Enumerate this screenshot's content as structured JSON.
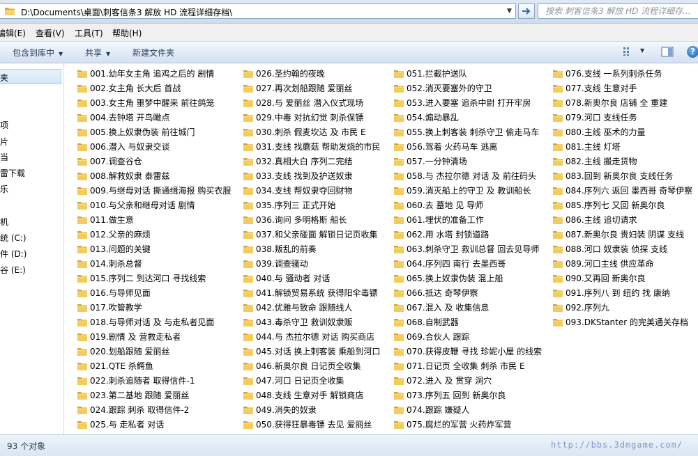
{
  "address": {
    "path": "D:\\Documents\\桌面\\刺客信条3 解放 HD 流程详细存档\\",
    "search_placeholder": "搜索 刺客信条3 解放 HD 流程详细存..."
  },
  "menu": [
    "编辑(E)",
    "查看(V)",
    "工具(T)",
    "帮助(H)"
  ],
  "toolbar": {
    "include_library": "包含到库中",
    "share": "共享",
    "new_folder": "新建文件夹"
  },
  "nav": [
    "夹",
    "项",
    "片",
    "当",
    "雷下载",
    "乐",
    "机",
    "统 (C:)",
    "件 (D:)",
    "谷 (E:)"
  ],
  "files": [
    "001.幼年女主角 追鸡之后的 剧情",
    "002.女主角 长大后 首战",
    "003.女主角 噩梦中醒来 前往鸽笼",
    "004.去钟塔 开鸟瞰点",
    "005.换上奴隶伪装 前往城门",
    "006.潜入 与奴隶交谈",
    "007.调查谷仓",
    "008.解救奴隶 泰雷兹",
    "009.与继母对话 撕通缉海报 购买衣服",
    "010.与父亲和继母对话 剧情",
    "011.做生意",
    "012.父亲的麻烦",
    "013.问题的关键",
    "014.刺杀总督",
    "015.序列二 到达河口 寻找线索",
    "016.与导师见面",
    "017.吹管教学",
    "018.与导师对话 及 与走私者见面",
    "019.剧情 及 营救走私者",
    "020.划船跟随 爱丽丝",
    "021.QTE 杀鳄鱼",
    "022.刺杀追随者 取得信件-1",
    "023.第二基地 跟随 爱丽丝",
    "024.跟踪 刺杀 取得信件-2",
    "025.与 走私者 对话",
    "026.圣约翰的夜晚",
    "027.再次划船跟随 爱丽丝",
    "028.与 爱丽丝 潜入仪式现场",
    "029.中毒 对抗幻觉 刺杀保镖",
    "030.刺杀 假麦坎达 及 市民 E",
    "031.支线 找蘑菇 帮助发烧的市民",
    "032.真相大白 序列二完结",
    "033.支线 找到及护送奴隶",
    "034.支线 帮奴隶夺回财物",
    "035.序列三 正式开始",
    "036.询问 多明格斯 船长",
    "037.和父亲碰面 解锁日记页收集",
    "038.叛乱的前奏",
    "039.调查骚动",
    "040.与 骚动者 对话",
    "041.解锁贸易系统 获得阳伞毒镖",
    "042.优雅与致命 跟随线人",
    "043.毒杀守卫 救训奴隶贩",
    "044.与 杰拉尔德 对话 购买商店",
    "045.对话 换上刺客装 乘船到河口",
    "046.新奥尔良 日记页全收集",
    "047.河口 日记页全收集",
    "048.支线 生意对手 解锁商店",
    "049.消失的奴隶",
    "050.获得狂暴毒镖 去见 爱丽丝",
    "051.拦截护送队",
    "052.消灭要塞外的守卫",
    "053.进入要塞 追杀中尉 打开牢房",
    "054.煽动暴乱",
    "055.换上刺客装 刺杀守卫 偷走马车",
    "056.驾着 火药马车 逃离",
    "057.一分钟清场",
    "058.与 杰拉尔德 对话 及 前往码头",
    "059.消灭船上的守卫 及 教训船长",
    "060.去 墓地 见 导师",
    "061.埋伏的准备工作",
    "062.用 水塔 封锁道路",
    "063.刺杀守卫 救训总督 回去见导师",
    "064.序列四 南行 去墨西哥",
    "065.换上奴隶伪装 混上船",
    "066.抵达 奇琴伊察",
    "067.混入 及 收集信息",
    "068.自制武器",
    "069.合伙人 跟踪",
    "070.获得皮鞭 寻找 珍妮小屋 的线索",
    "071.日记页 全收集 刺杀 市民 E",
    "072.进入 及 贯穿 洞穴",
    "073.序列五 回到 新奥尔良",
    "074.跟踪 嫌疑人",
    "075.腐烂的军营 火药炸军营",
    "076.支线 一系列刺杀任务",
    "077.支线 生意对手",
    "078.新奥尔良 店铺 全 重建",
    "079.河口 支线任务",
    "080.主线 巫术的力量",
    "081.主线 灯塔",
    "082.主线 搬走货物",
    "083.回到 新奥尔良 支线任务",
    "084.序列六 返回 墨西哥 奇琴伊察",
    "085.序列七 又回 新奥尔良",
    "086.主线 追切请求",
    "087.新奥尔良 贵妇装 阴谋 支线",
    "088.河口 奴隶装 侦探 支线",
    "089.河口主线 供应革命",
    "090.又再回 新奥尔良",
    "091.序列八 到 纽约 找 康纳",
    "092.序列九",
    "093.DKStanter 的完美通关存档"
  ],
  "status": {
    "count": "93 个对象",
    "watermark": "http://bbs.3dmgame.com/"
  },
  "colors": {
    "folder": "#e9b73a",
    "toolbar_text": "#1e395b",
    "search_placeholder": "#8d96a3"
  }
}
